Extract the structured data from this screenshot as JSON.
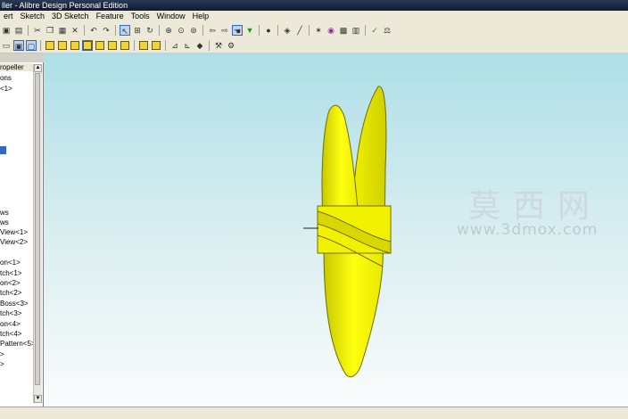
{
  "window": {
    "title": "ller - Alibre Design Personal Edition"
  },
  "menu": [
    {
      "label": "ert"
    },
    {
      "label": "Sketch"
    },
    {
      "label": "3D Sketch"
    },
    {
      "label": "Feature"
    },
    {
      "label": "Tools"
    },
    {
      "label": "Window"
    },
    {
      "label": "Help"
    }
  ],
  "tree": {
    "items": [
      {
        "label": "ropeller"
      },
      {
        "label": "ons"
      },
      {
        "label": "<1>"
      },
      {
        "label": ""
      },
      {
        "label": "ws"
      },
      {
        "label": "ws"
      },
      {
        "label": "View<1>"
      },
      {
        "label": "View<2>"
      },
      {
        "label": "on<1>"
      },
      {
        "label": "tch<1>"
      },
      {
        "label": "on<2>"
      },
      {
        "label": "tch<2>"
      },
      {
        "label": "Boss<3>"
      },
      {
        "label": "tch<3>"
      },
      {
        "label": "on<4>"
      },
      {
        "label": "tch<4>"
      },
      {
        "label": "Pattern<5>"
      }
    ]
  },
  "watermark": {
    "chinese": "莫西网",
    "url": "www.3dmox.com"
  },
  "colors": {
    "part_fill": "#ffff00",
    "part_edge": "#6f6f00",
    "viewport_top": "#aedfe7",
    "viewport_bottom": "#fafcfc"
  }
}
